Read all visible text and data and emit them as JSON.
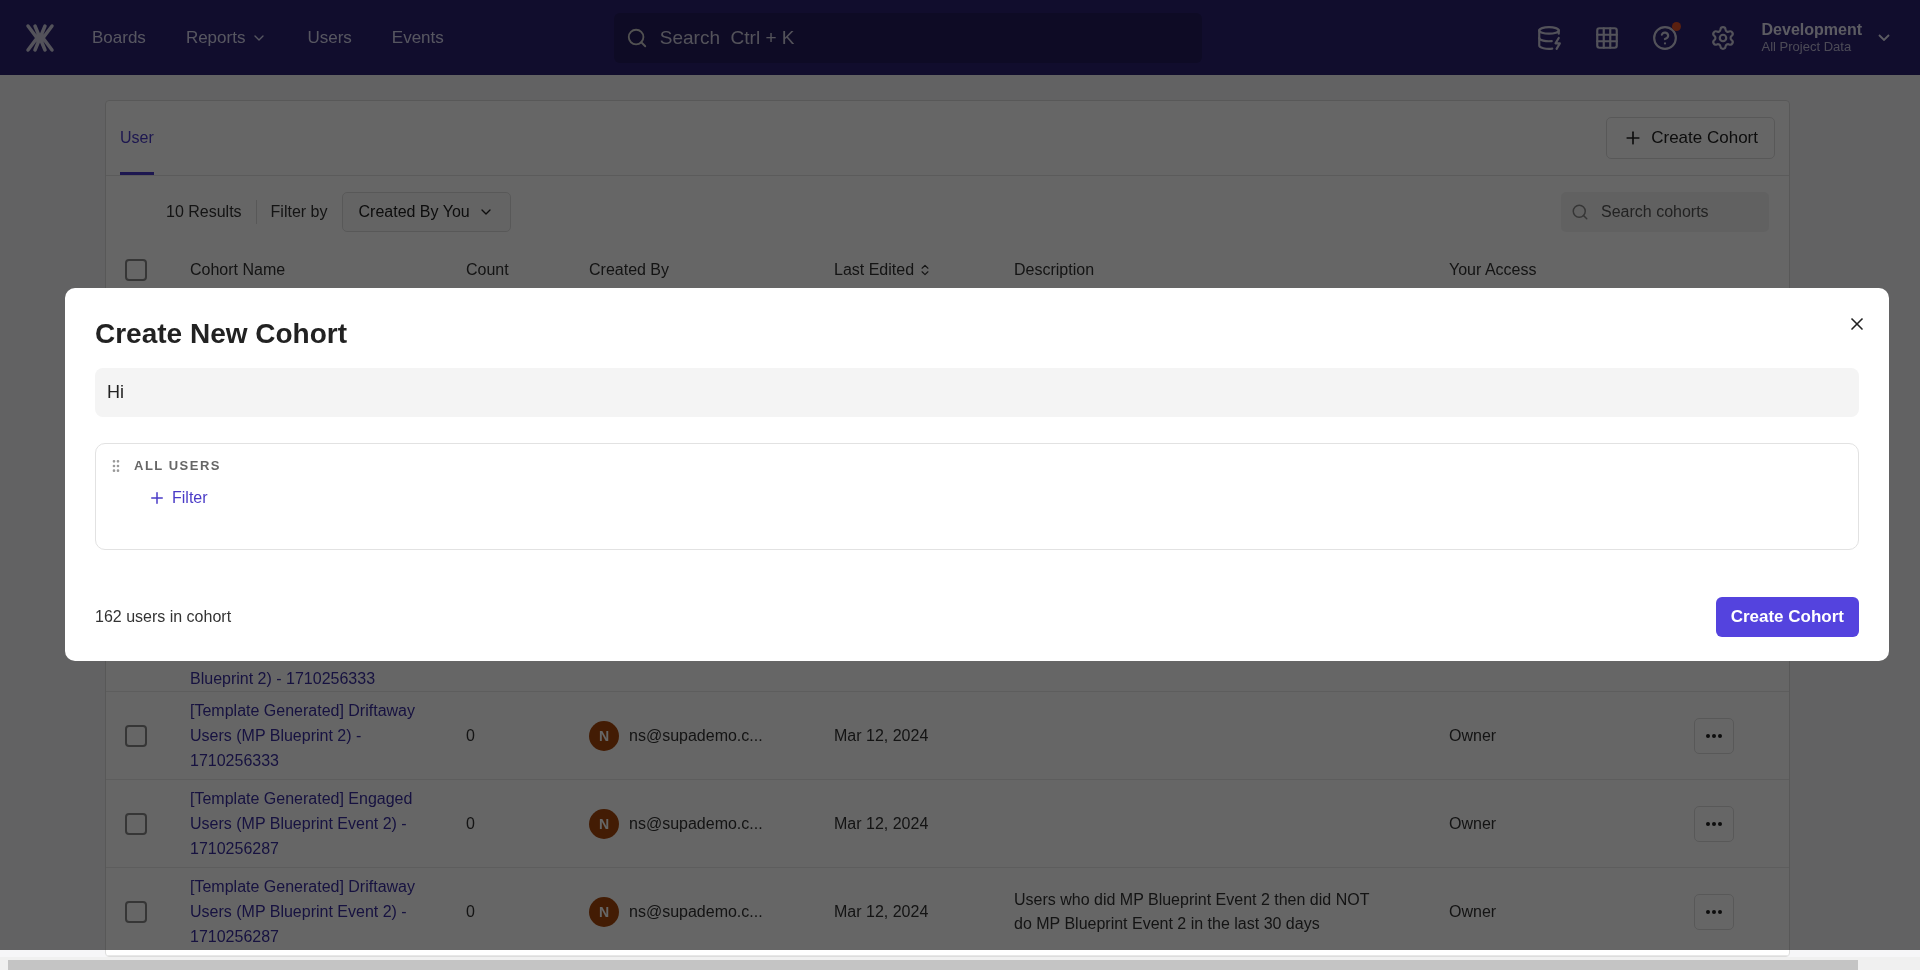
{
  "nav": {
    "items": [
      {
        "label": "Boards",
        "dropdown": false
      },
      {
        "label": "Reports",
        "dropdown": true
      },
      {
        "label": "Users",
        "dropdown": false
      },
      {
        "label": "Events",
        "dropdown": false
      }
    ],
    "search": {
      "placeholder": "Search  Ctrl + K"
    },
    "project": {
      "name": "Development",
      "scope": "All Project Data"
    }
  },
  "page": {
    "tabs": [
      {
        "label": "User",
        "selected": true
      }
    ],
    "create_button": "Create Cohort",
    "results": "10 Results",
    "filter_label": "Filter by",
    "filter_value": "Created By You",
    "search": {
      "placeholder": "Search cohorts"
    },
    "select_all_checked": false,
    "columns": [
      {
        "label": "Cohort Name",
        "sortable": false
      },
      {
        "label": "Count",
        "sortable": false
      },
      {
        "label": "Created By",
        "sortable": false
      },
      {
        "label": "Last Edited",
        "sortable": true
      },
      {
        "label": "Description",
        "sortable": false
      },
      {
        "label": "Your Access",
        "sortable": false
      }
    ],
    "partial_row": "Blueprint 2) - 1710256333",
    "rows": [
      {
        "name": "[Template Generated] Driftaway Users (MP Blueprint 2) - 1710256333",
        "count": "0",
        "initial": "N",
        "creator": "ns@supademo.c...",
        "edited": "Mar 12, 2024",
        "description": "",
        "access": "Owner",
        "checked": false
      },
      {
        "name": "[Template Generated] Engaged Users (MP Blueprint Event 2) - 1710256287",
        "count": "0",
        "initial": "N",
        "creator": "ns@supademo.c...",
        "edited": "Mar 12, 2024",
        "description": "",
        "access": "Owner",
        "checked": false
      },
      {
        "name": "[Template Generated] Driftaway Users (MP Blueprint Event 2) - 1710256287",
        "count": "0",
        "initial": "N",
        "creator": "ns@supademo.c...",
        "edited": "Mar 12, 2024",
        "description": "Users who did MP Blueprint Event 2 then did NOT do MP Blueprint Event 2 in the last 30 days",
        "access": "Owner",
        "checked": false
      }
    ]
  },
  "modal": {
    "title": "Create New Cohort",
    "name_value": "Hi",
    "group_label": "ALL USERS",
    "add_filter": "Filter",
    "summary": "162 users in cohort",
    "submit": "Create Cohort"
  }
}
